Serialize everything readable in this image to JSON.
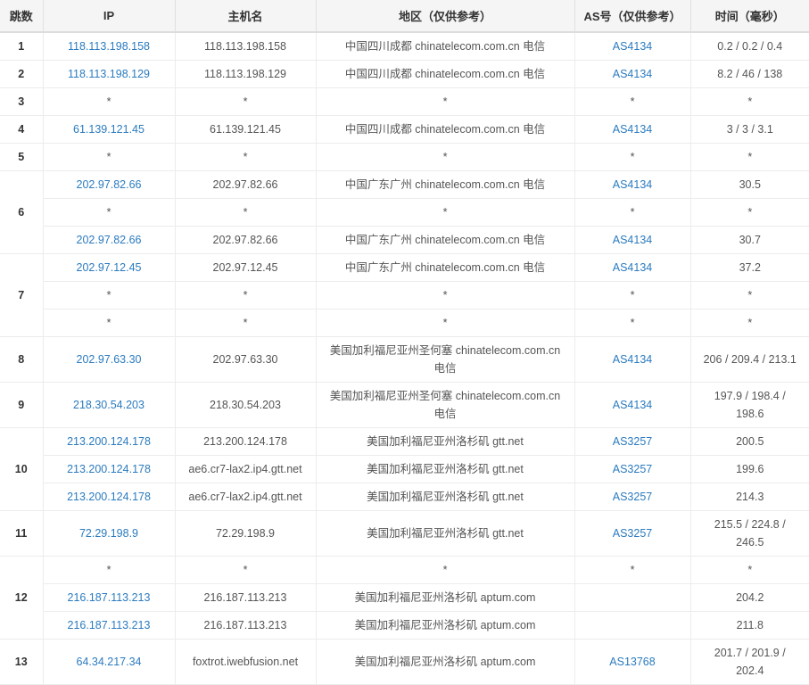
{
  "table": {
    "headers": [
      "跳数",
      "IP",
      "主机名",
      "地区（仅供参考）",
      "AS号（仅供参考）",
      "时间（毫秒）"
    ],
    "rows": [
      {
        "hop": "1",
        "entries": [
          {
            "ip": "118.113.198.158",
            "ip_link": true,
            "hostname": "118.113.198.158",
            "region": "中国四川成都 chinatelecom.com.cn 电信",
            "as": "AS4134",
            "as_link": true,
            "time": "0.2 / 0.2 / 0.4"
          }
        ]
      },
      {
        "hop": "2",
        "entries": [
          {
            "ip": "118.113.198.129",
            "ip_link": true,
            "hostname": "118.113.198.129",
            "region": "中国四川成都 chinatelecom.com.cn 电信",
            "as": "AS4134",
            "as_link": true,
            "time": "8.2 / 46 / 138"
          }
        ]
      },
      {
        "hop": "3",
        "entries": [
          {
            "ip": "*",
            "ip_link": false,
            "hostname": "*",
            "region": "*",
            "as": "*",
            "as_link": false,
            "time": "*"
          }
        ]
      },
      {
        "hop": "4",
        "entries": [
          {
            "ip": "61.139.121.45",
            "ip_link": true,
            "hostname": "61.139.121.45",
            "region": "中国四川成都 chinatelecom.com.cn 电信",
            "as": "AS4134",
            "as_link": true,
            "time": "3 / 3 / 3.1"
          }
        ]
      },
      {
        "hop": "5",
        "entries": [
          {
            "ip": "*",
            "ip_link": false,
            "hostname": "*",
            "region": "*",
            "as": "*",
            "as_link": false,
            "time": "*"
          }
        ]
      },
      {
        "hop": "6",
        "entries": [
          {
            "ip": "202.97.82.66",
            "ip_link": true,
            "hostname": "202.97.82.66",
            "region": "中国广东广州 chinatelecom.com.cn 电信",
            "as": "AS4134",
            "as_link": true,
            "time": "30.5"
          },
          {
            "ip": "*",
            "ip_link": false,
            "hostname": "*",
            "region": "*",
            "as": "*",
            "as_link": false,
            "time": "*"
          },
          {
            "ip": "202.97.82.66",
            "ip_link": true,
            "hostname": "202.97.82.66",
            "region": "中国广东广州 chinatelecom.com.cn 电信",
            "as": "AS4134",
            "as_link": true,
            "time": "30.7"
          }
        ]
      },
      {
        "hop": "7",
        "entries": [
          {
            "ip": "202.97.12.45",
            "ip_link": true,
            "hostname": "202.97.12.45",
            "region": "中国广东广州 chinatelecom.com.cn 电信",
            "as": "AS4134",
            "as_link": true,
            "time": "37.2"
          },
          {
            "ip": "*",
            "ip_link": false,
            "hostname": "*",
            "region": "*",
            "as": "*",
            "as_link": false,
            "time": "*"
          },
          {
            "ip": "*",
            "ip_link": false,
            "hostname": "*",
            "region": "*",
            "as": "*",
            "as_link": false,
            "time": "*"
          }
        ]
      },
      {
        "hop": "8",
        "entries": [
          {
            "ip": "202.97.63.30",
            "ip_link": true,
            "hostname": "202.97.63.30",
            "region": "美国加利福尼亚州圣何塞 chinatelecom.com.cn 电信",
            "as": "AS4134",
            "as_link": true,
            "time": "206 / 209.4 / 213.1"
          }
        ]
      },
      {
        "hop": "9",
        "entries": [
          {
            "ip": "218.30.54.203",
            "ip_link": true,
            "hostname": "218.30.54.203",
            "region": "美国加利福尼亚州圣何塞 chinatelecom.com.cn 电信",
            "as": "AS4134",
            "as_link": true,
            "time": "197.9 / 198.4 / 198.6"
          }
        ]
      },
      {
        "hop": "10",
        "entries": [
          {
            "ip": "213.200.124.178",
            "ip_link": true,
            "hostname": "213.200.124.178",
            "region": "美国加利福尼亚州洛杉矶 gtt.net",
            "as": "AS3257",
            "as_link": true,
            "time": "200.5"
          },
          {
            "ip": "213.200.124.178",
            "ip_link": true,
            "hostname": "ae6.cr7-lax2.ip4.gtt.net",
            "region": "美国加利福尼亚州洛杉矶 gtt.net",
            "as": "AS3257",
            "as_link": true,
            "time": "199.6"
          },
          {
            "ip": "213.200.124.178",
            "ip_link": true,
            "hostname": "ae6.cr7-lax2.ip4.gtt.net",
            "region": "美国加利福尼亚州洛杉矶 gtt.net",
            "as": "AS3257",
            "as_link": true,
            "time": "214.3"
          }
        ]
      },
      {
        "hop": "11",
        "entries": [
          {
            "ip": "72.29.198.9",
            "ip_link": true,
            "hostname": "72.29.198.9",
            "region": "美国加利福尼亚州洛杉矶 gtt.net",
            "as": "AS3257",
            "as_link": true,
            "time": "215.5 / 224.8 / 246.5"
          }
        ]
      },
      {
        "hop": "12",
        "entries": [
          {
            "ip": "*",
            "ip_link": false,
            "hostname": "*",
            "region": "*",
            "as": "*",
            "as_link": false,
            "time": "*"
          },
          {
            "ip": "216.187.113.213",
            "ip_link": true,
            "hostname": "216.187.113.213",
            "region": "美国加利福尼亚州洛杉矶 aptum.com",
            "as": "",
            "as_link": false,
            "time": "204.2"
          },
          {
            "ip": "216.187.113.213",
            "ip_link": true,
            "hostname": "216.187.113.213",
            "region": "美国加利福尼亚州洛杉矶 aptum.com",
            "as": "",
            "as_link": false,
            "time": "211.8"
          }
        ]
      },
      {
        "hop": "13",
        "entries": [
          {
            "ip": "64.34.217.34",
            "ip_link": true,
            "hostname": "foxtrot.iwebfusion.net",
            "region": "美国加利福尼亚州洛杉矶 aptum.com",
            "as": "AS13768",
            "as_link": true,
            "time": "201.7 / 201.9 / 202.4"
          }
        ]
      }
    ]
  }
}
